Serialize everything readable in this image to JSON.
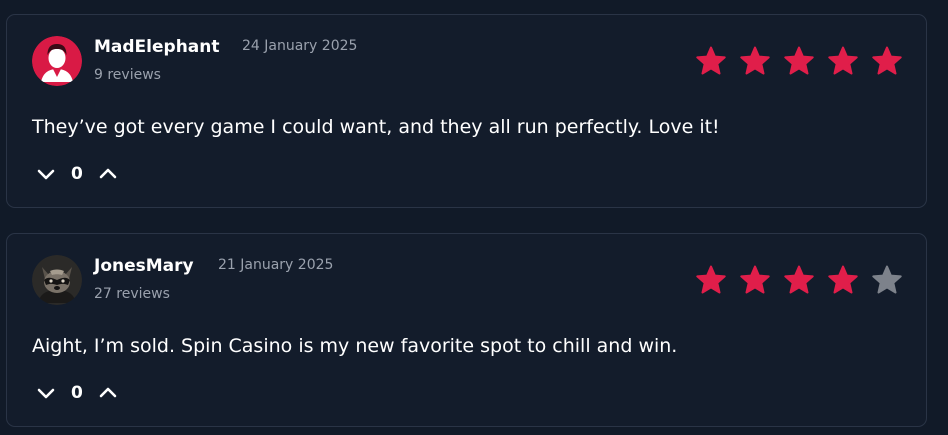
{
  "reviews": [
    {
      "name": "MadElephant",
      "date": "24 January 2025",
      "review_count": "9 reviews",
      "rating": 5,
      "max_rating": 5,
      "text": "They’ve got every game I could want, and they all run perfectly. Love it!",
      "votes": "0",
      "avatar_icon": "person-avatar-icon"
    },
    {
      "name": "JonesMary",
      "date": "21 January 2025",
      "review_count": "27 reviews",
      "rating": 4,
      "max_rating": 5,
      "text": "Aight, I’m sold. Spin Casino is my new favorite spot to chill and win.",
      "votes": "0",
      "avatar_icon": "raccoon-avatar-icon"
    }
  ],
  "colors": {
    "star_active": "#e01e4a",
    "star_inactive": "#7d828b",
    "background": "#111a28",
    "card": "#131c2b",
    "muted_text": "#9aa1ad"
  }
}
